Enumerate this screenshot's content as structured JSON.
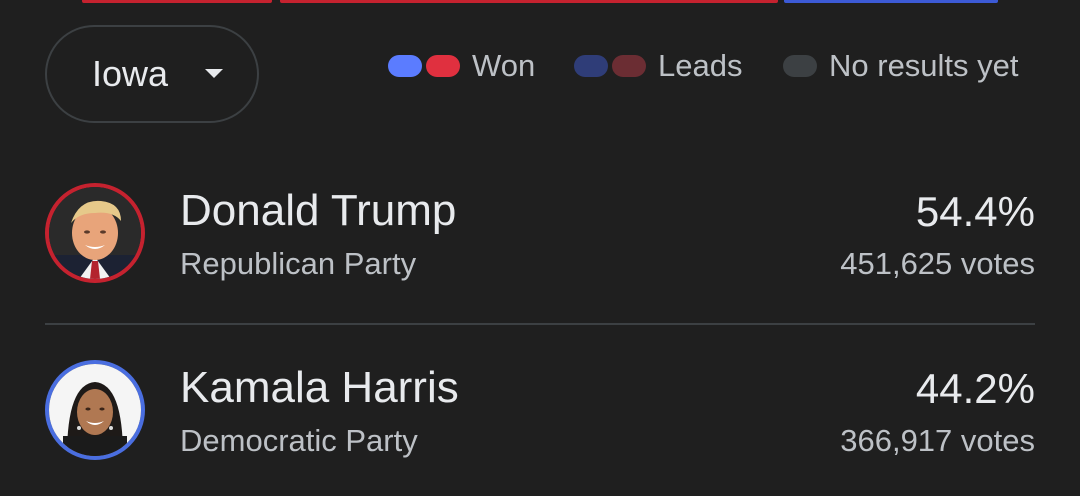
{
  "state_selector": {
    "label": "Iowa"
  },
  "legend": {
    "won": {
      "label": "Won",
      "colors": [
        "#5b7cff",
        "#e0303f"
      ]
    },
    "leads": {
      "label": "Leads",
      "colors": [
        "#2f3d78",
        "#6b2d33"
      ]
    },
    "no_results": {
      "label": "No results yet",
      "color": "#3c4043"
    }
  },
  "candidates": [
    {
      "name": "Donald Trump",
      "party": "Republican Party",
      "percent": "54.4%",
      "votes": "451,625 votes",
      "ring_color": "#c5222f",
      "avatar_icon": "candidate-photo"
    },
    {
      "name": "Kamala Harris",
      "party": "Democratic Party",
      "percent": "44.2%",
      "votes": "366,917 votes",
      "ring_color": "#4a6ee0",
      "avatar_icon": "candidate-photo"
    }
  ],
  "top_bar_colors": {
    "republican": "#c5222f",
    "democrat": "#3c5ad6"
  }
}
